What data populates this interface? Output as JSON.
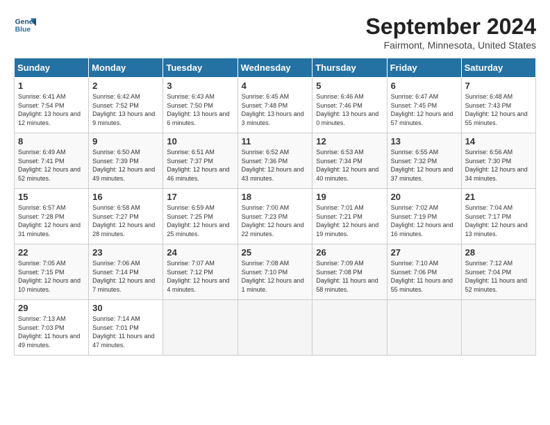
{
  "header": {
    "logo_line1": "General",
    "logo_line2": "Blue",
    "month_title": "September 2024",
    "location": "Fairmont, Minnesota, United States"
  },
  "weekdays": [
    "Sunday",
    "Monday",
    "Tuesday",
    "Wednesday",
    "Thursday",
    "Friday",
    "Saturday"
  ],
  "weeks": [
    [
      {
        "day": "1",
        "sunrise": "6:41 AM",
        "sunset": "7:54 PM",
        "daylight": "13 hours and 12 minutes."
      },
      {
        "day": "2",
        "sunrise": "6:42 AM",
        "sunset": "7:52 PM",
        "daylight": "13 hours and 9 minutes."
      },
      {
        "day": "3",
        "sunrise": "6:43 AM",
        "sunset": "7:50 PM",
        "daylight": "13 hours and 6 minutes."
      },
      {
        "day": "4",
        "sunrise": "6:45 AM",
        "sunset": "7:48 PM",
        "daylight": "13 hours and 3 minutes."
      },
      {
        "day": "5",
        "sunrise": "6:46 AM",
        "sunset": "7:46 PM",
        "daylight": "13 hours and 0 minutes."
      },
      {
        "day": "6",
        "sunrise": "6:47 AM",
        "sunset": "7:45 PM",
        "daylight": "12 hours and 57 minutes."
      },
      {
        "day": "7",
        "sunrise": "6:48 AM",
        "sunset": "7:43 PM",
        "daylight": "12 hours and 55 minutes."
      }
    ],
    [
      {
        "day": "8",
        "sunrise": "6:49 AM",
        "sunset": "7:41 PM",
        "daylight": "12 hours and 52 minutes."
      },
      {
        "day": "9",
        "sunrise": "6:50 AM",
        "sunset": "7:39 PM",
        "daylight": "12 hours and 49 minutes."
      },
      {
        "day": "10",
        "sunrise": "6:51 AM",
        "sunset": "7:37 PM",
        "daylight": "12 hours and 46 minutes."
      },
      {
        "day": "11",
        "sunrise": "6:52 AM",
        "sunset": "7:36 PM",
        "daylight": "12 hours and 43 minutes."
      },
      {
        "day": "12",
        "sunrise": "6:53 AM",
        "sunset": "7:34 PM",
        "daylight": "12 hours and 40 minutes."
      },
      {
        "day": "13",
        "sunrise": "6:55 AM",
        "sunset": "7:32 PM",
        "daylight": "12 hours and 37 minutes."
      },
      {
        "day": "14",
        "sunrise": "6:56 AM",
        "sunset": "7:30 PM",
        "daylight": "12 hours and 34 minutes."
      }
    ],
    [
      {
        "day": "15",
        "sunrise": "6:57 AM",
        "sunset": "7:28 PM",
        "daylight": "12 hours and 31 minutes."
      },
      {
        "day": "16",
        "sunrise": "6:58 AM",
        "sunset": "7:27 PM",
        "daylight": "12 hours and 28 minutes."
      },
      {
        "day": "17",
        "sunrise": "6:59 AM",
        "sunset": "7:25 PM",
        "daylight": "12 hours and 25 minutes."
      },
      {
        "day": "18",
        "sunrise": "7:00 AM",
        "sunset": "7:23 PM",
        "daylight": "12 hours and 22 minutes."
      },
      {
        "day": "19",
        "sunrise": "7:01 AM",
        "sunset": "7:21 PM",
        "daylight": "12 hours and 19 minutes."
      },
      {
        "day": "20",
        "sunrise": "7:02 AM",
        "sunset": "7:19 PM",
        "daylight": "12 hours and 16 minutes."
      },
      {
        "day": "21",
        "sunrise": "7:04 AM",
        "sunset": "7:17 PM",
        "daylight": "12 hours and 13 minutes."
      }
    ],
    [
      {
        "day": "22",
        "sunrise": "7:05 AM",
        "sunset": "7:15 PM",
        "daylight": "12 hours and 10 minutes."
      },
      {
        "day": "23",
        "sunrise": "7:06 AM",
        "sunset": "7:14 PM",
        "daylight": "12 hours and 7 minutes."
      },
      {
        "day": "24",
        "sunrise": "7:07 AM",
        "sunset": "7:12 PM",
        "daylight": "12 hours and 4 minutes."
      },
      {
        "day": "25",
        "sunrise": "7:08 AM",
        "sunset": "7:10 PM",
        "daylight": "12 hours and 1 minute."
      },
      {
        "day": "26",
        "sunrise": "7:09 AM",
        "sunset": "7:08 PM",
        "daylight": "11 hours and 58 minutes."
      },
      {
        "day": "27",
        "sunrise": "7:10 AM",
        "sunset": "7:06 PM",
        "daylight": "11 hours and 55 minutes."
      },
      {
        "day": "28",
        "sunrise": "7:12 AM",
        "sunset": "7:04 PM",
        "daylight": "11 hours and 52 minutes."
      }
    ],
    [
      {
        "day": "29",
        "sunrise": "7:13 AM",
        "sunset": "7:03 PM",
        "daylight": "11 hours and 49 minutes."
      },
      {
        "day": "30",
        "sunrise": "7:14 AM",
        "sunset": "7:01 PM",
        "daylight": "11 hours and 47 minutes."
      },
      null,
      null,
      null,
      null,
      null
    ]
  ]
}
